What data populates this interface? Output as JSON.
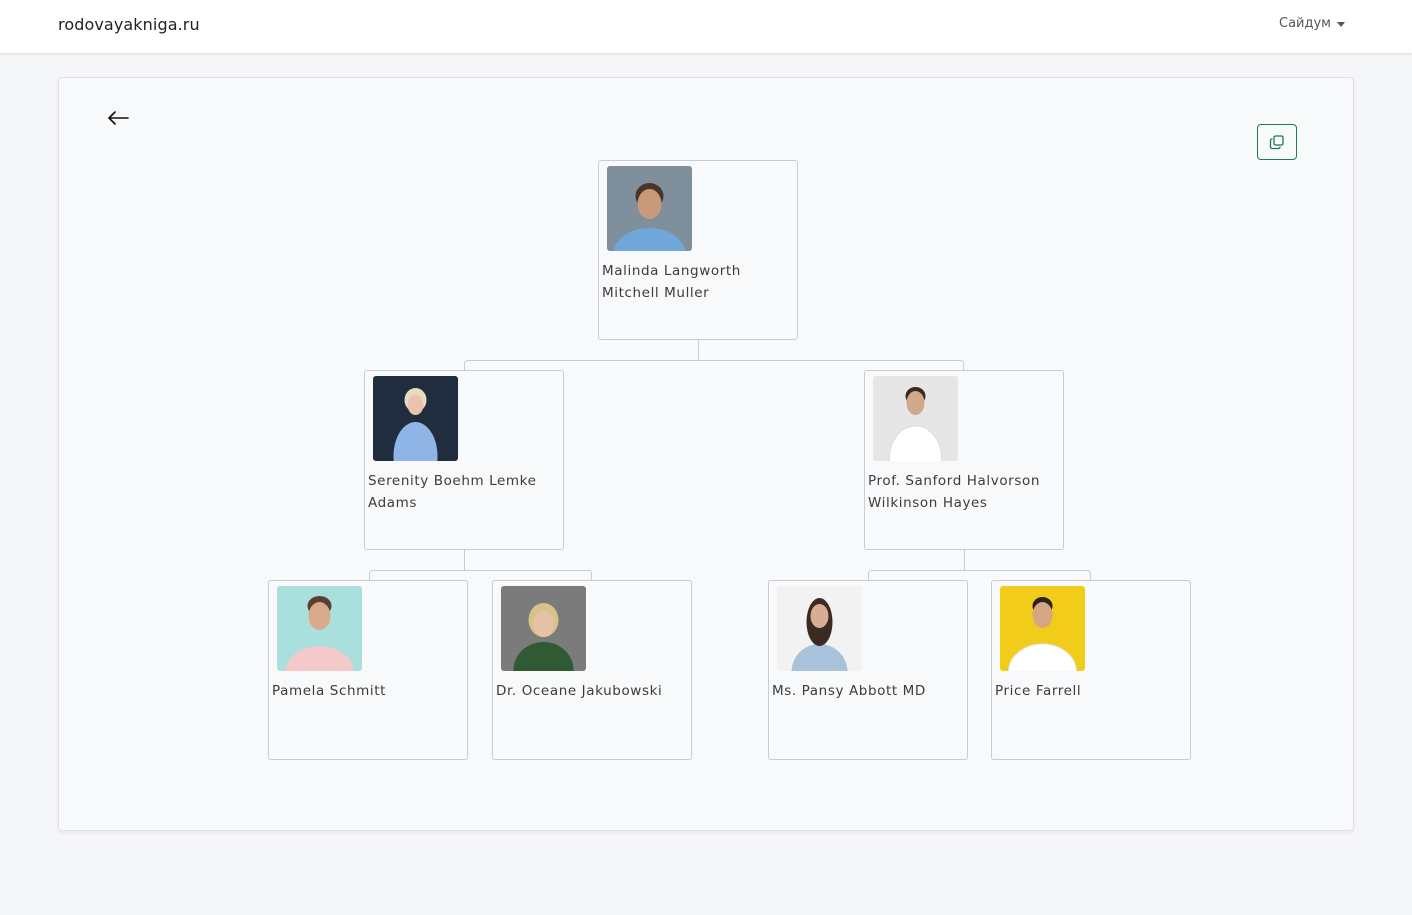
{
  "navbar": {
    "brand": "rodovayakniga.ru",
    "user_name": "Сайдум"
  },
  "toolbar": {
    "back_icon": "arrow-left-icon",
    "copy_icon": "copy-icon",
    "accent_color": "#1e7a4f"
  },
  "tree": {
    "root": {
      "name": "Malinda Langworth Mitchell Muller",
      "photo_bg": "#7f8f9c",
      "skin": "#c99a7a",
      "hair": "#4a3526",
      "shirt": "#6fa7d8"
    },
    "children": [
      {
        "name": "Serenity Boehm Lemke Adams",
        "photo_bg": "#1f2d3f",
        "skin": "#e8c4ae",
        "hair": "#e7dcc0",
        "shirt": "#8fb4e6"
      },
      {
        "name": "Prof. Sanford Halvorson Wilkinson Hayes",
        "photo_bg": "#e6e6e6",
        "skin": "#d2a88c",
        "hair": "#3a2a20",
        "shirt": "#ffffff"
      }
    ],
    "grandchildren": [
      {
        "name": "Pamela Schmitt",
        "photo_bg": "#a9e0de",
        "skin": "#d9a98c",
        "hair": "#5a3f2e",
        "shirt": "#f3c9c9"
      },
      {
        "name": "Dr. Oceane Jakubowski",
        "photo_bg": "#7b7b7b",
        "skin": "#e6c2a6",
        "hair": "#d9c289",
        "shirt": "#2f5a34"
      },
      {
        "name": "Ms. Pansy Abbott MD",
        "photo_bg": "#f2f2f2",
        "skin": "#d9ad93",
        "hair": "#3b2a22",
        "shirt": "#a8c2da"
      },
      {
        "name": "Price Farrell",
        "photo_bg": "#f2cc1a",
        "skin": "#d6a583",
        "hair": "#2e221a",
        "shirt": "#ffffff"
      }
    ]
  }
}
